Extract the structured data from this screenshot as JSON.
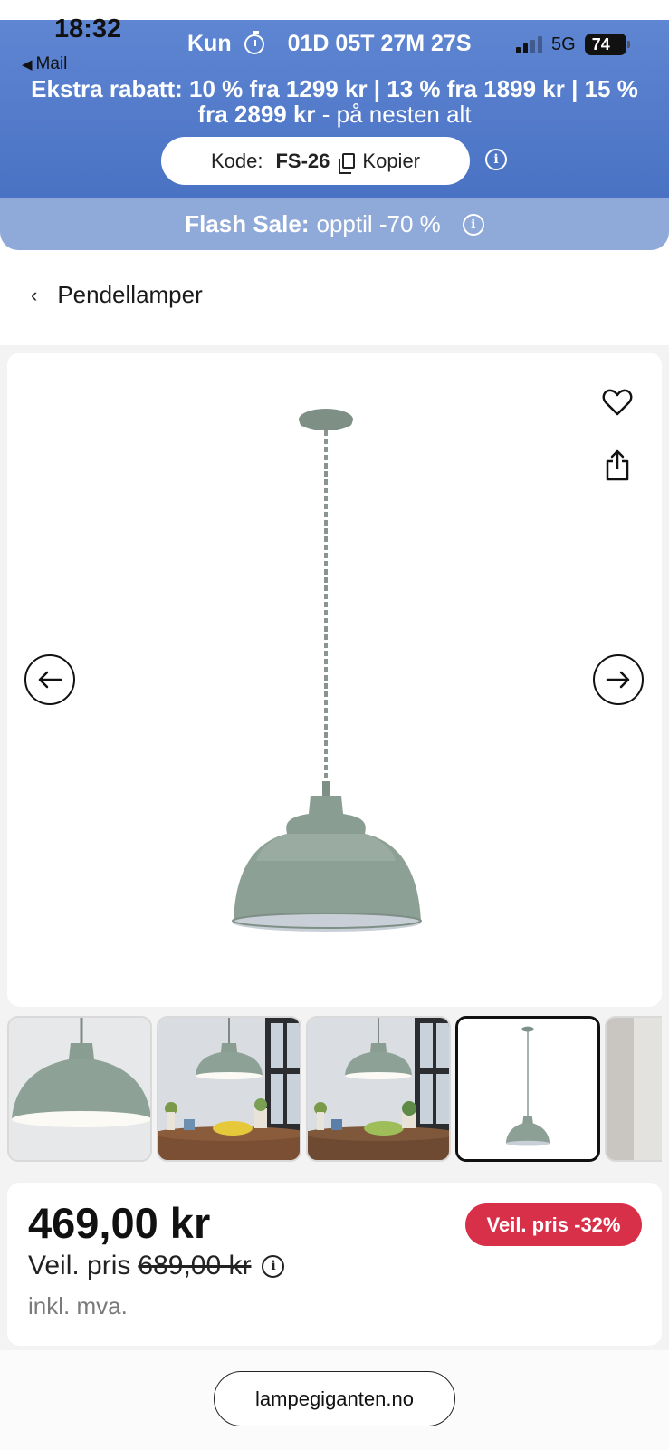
{
  "status_bar": {
    "time": "18:32",
    "back_app": "Mail",
    "network": "5G",
    "battery": "74"
  },
  "promo": {
    "countdown_prefix": "Kun",
    "countdown_value": "01D 05T 27M 27S",
    "discount_bold": "Ekstra rabatt: 10 % fra 1299 kr | 13 % fra 1899 kr | 15 % fra 2899 kr",
    "discount_rest": " - på nesten alt",
    "code_label": "Kode:",
    "code_value": "FS-26",
    "copy_label": "Kopier",
    "flash_bold": "Flash Sale:",
    "flash_rest": "opptil -70 %",
    "bg_color": "#4a72c4",
    "flash_bg_color": "#8fa9d9"
  },
  "breadcrumb": {
    "label": "Pendellamper"
  },
  "gallery": {
    "thumb_count": 5,
    "active_thumb_index": 3
  },
  "pricing": {
    "price": "469,00 kr",
    "badge": "Veil. pris -32%",
    "old_prefix": "Veil. pris",
    "old_price": "689,00 kr",
    "vat_note": "inkl. mva.",
    "badge_color": "#d9304a"
  },
  "browser": {
    "url": "lampegiganten.no"
  },
  "icons": {
    "timer": "timer-icon",
    "copy": "copy-icon",
    "info": "info-icon",
    "back": "chevron-left-icon",
    "favorite": "heart-icon",
    "share": "share-icon",
    "prev": "arrow-left-icon",
    "next": "arrow-right-icon"
  }
}
